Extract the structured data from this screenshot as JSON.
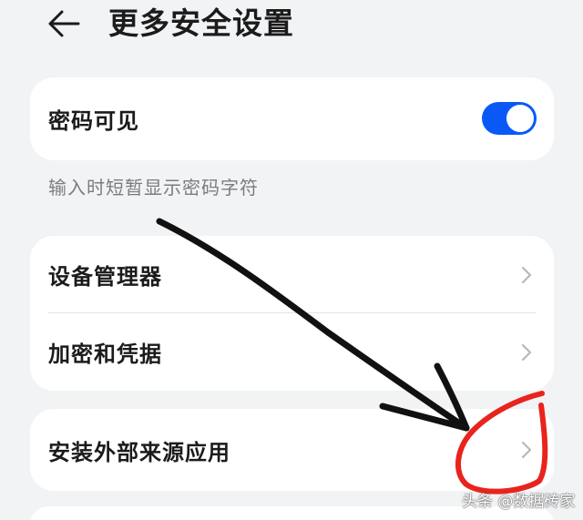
{
  "header": {
    "title": "更多安全设置"
  },
  "password_visible": {
    "label": "密码可见",
    "enabled": true,
    "description": "输入时短暂显示密码字符"
  },
  "list": {
    "device_manager": "设备管理器",
    "encryption": "加密和凭据",
    "external_sources": "安装外部来源应用"
  },
  "watermark": "头条 @数据砖家",
  "colors": {
    "accent": "#0a59f7",
    "background": "#f1f3f5",
    "annotation_red": "#e8241c",
    "annotation_black": "#111111"
  }
}
